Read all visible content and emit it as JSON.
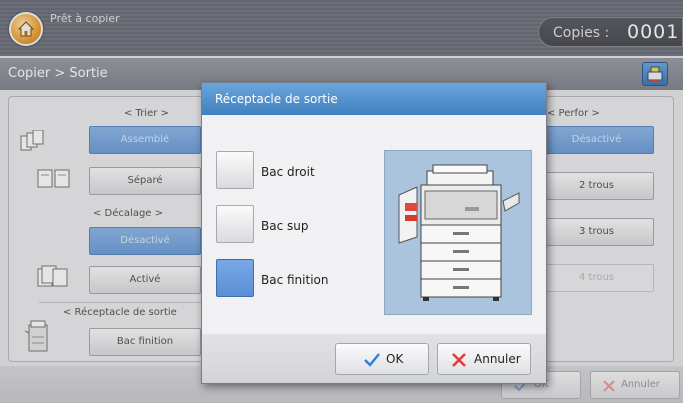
{
  "status": {
    "text": "Prêt à copier",
    "home_icon": "home-icon"
  },
  "copies": {
    "label": "Copies :",
    "value": "0001"
  },
  "breadcrumb": {
    "text": "Copier > Sortie",
    "icon": "output-settings-icon"
  },
  "groups": {
    "trier": {
      "label": "< Trier >",
      "options": [
        {
          "label": "Assemblé",
          "state": "selected"
        },
        {
          "label": "Séparé",
          "state": "normal"
        }
      ]
    },
    "decalage": {
      "label": "< Décalage >",
      "options": [
        {
          "label": "Désactivé",
          "state": "selected"
        },
        {
          "label": "Activé",
          "state": "normal"
        }
      ]
    },
    "receptacle": {
      "label": "< Réceptacle de sortie",
      "value": "Bac finition"
    },
    "perfor": {
      "label": "< Perfor >",
      "options": [
        {
          "label": "Désactivé",
          "state": "selected"
        },
        {
          "label": "2 trous",
          "state": "normal"
        },
        {
          "label": "3 trous",
          "state": "normal"
        },
        {
          "label": "4 trous",
          "state": "disabled"
        }
      ]
    }
  },
  "bottom": {
    "ok_label": "OK",
    "cancel_label": "Annuler"
  },
  "dialog": {
    "title": "Réceptacle de sortie",
    "options": [
      {
        "label": "Bac droit",
        "checked": false
      },
      {
        "label": "Bac sup",
        "checked": false
      },
      {
        "label": "Bac finition",
        "checked": true
      }
    ],
    "ok_label": "OK",
    "cancel_label": "Annuler"
  },
  "colors": {
    "accent_blue": "#6aa6dc",
    "ok_check": "#2f7fd6",
    "cancel_x": "#e53a3a"
  }
}
